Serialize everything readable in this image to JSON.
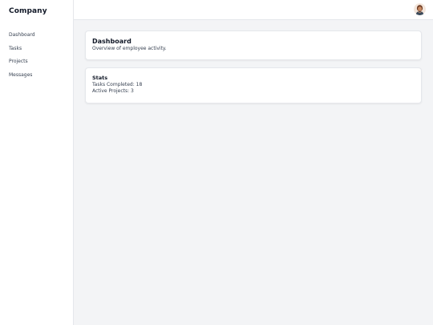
{
  "sidebar": {
    "brand": "Company",
    "items": [
      {
        "label": "Dashboard"
      },
      {
        "label": "Tasks"
      },
      {
        "label": "Projects"
      },
      {
        "label": "Messages"
      }
    ]
  },
  "topbar": {
    "avatar_icon": "user-avatar"
  },
  "dashboard_card": {
    "title": "Dashboard",
    "subtitle": "Overview of employee activity."
  },
  "stats_card": {
    "title": "Stats",
    "tasks_completed": "Tasks Completed: 18",
    "active_projects": "Active Projects: 3"
  },
  "colors": {
    "background": "#f3f4f6",
    "panel": "#ffffff",
    "border": "#e5e7eb",
    "text": "#111827"
  }
}
